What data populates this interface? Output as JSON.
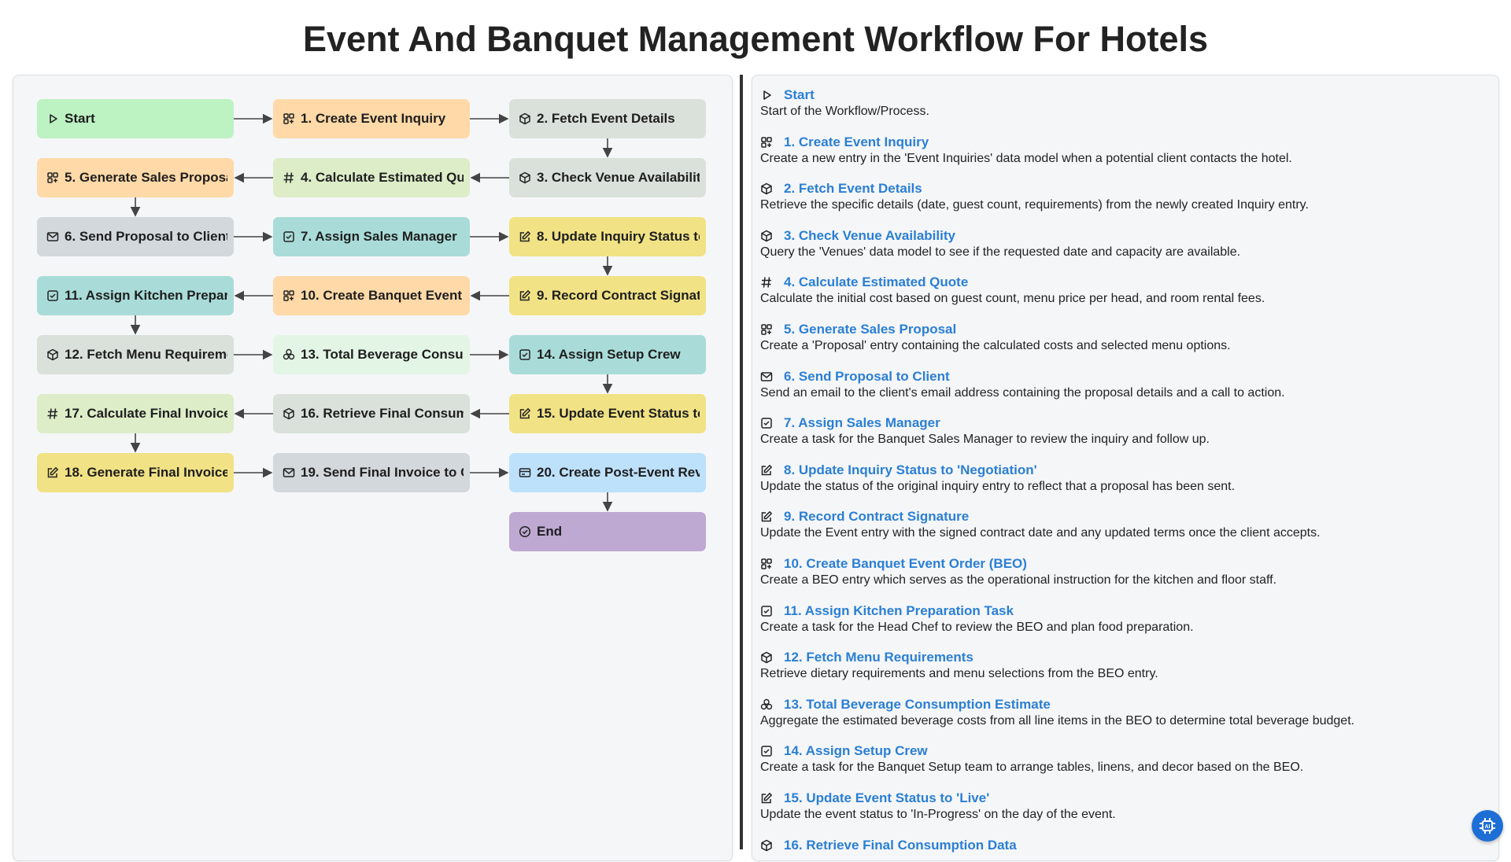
{
  "title": "Event And Banquet Management Workflow For Hotels",
  "colors": {
    "green": "#bdf2c2",
    "orange": "#ffd9a8",
    "gray": "#d9e1da",
    "lime": "#dcedc8",
    "slate": "#d2d8dc",
    "teal": "#a9dcd9",
    "yellow": "#f1e285",
    "mint": "#e3f5e5",
    "blue": "#bde0fb",
    "purple": "#bea9d2",
    "link": "#2a7fd4"
  },
  "nodes": [
    {
      "id": "start",
      "label": "Start",
      "icon": "play-icon",
      "color": "#bdf2c2"
    },
    {
      "id": "n1",
      "label": "1. Create Event Inquiry",
      "icon": "grid-plus-icon",
      "color": "#ffd9a8"
    },
    {
      "id": "n2",
      "label": "2. Fetch Event Details",
      "icon": "cube-icon",
      "color": "#d9e1da"
    },
    {
      "id": "n3",
      "label": "3. Check Venue Availability",
      "icon": "cube-icon",
      "color": "#d9e1da"
    },
    {
      "id": "n4",
      "label": "4. Calculate Estimated Quo",
      "icon": "hash-icon",
      "color": "#dcedc8"
    },
    {
      "id": "n5",
      "label": "5. Generate Sales Proposal",
      "icon": "grid-plus-icon",
      "color": "#ffd9a8"
    },
    {
      "id": "n6",
      "label": "6. Send Proposal to Client",
      "icon": "mail-icon",
      "color": "#d2d8dc"
    },
    {
      "id": "n7",
      "label": "7. Assign Sales Manager",
      "icon": "check-square-icon",
      "color": "#a9dcd9"
    },
    {
      "id": "n8",
      "label": "8. Update Inquiry Status to",
      "icon": "edit-icon",
      "color": "#f1e285"
    },
    {
      "id": "n9",
      "label": "9. Record Contract Signatu",
      "icon": "edit-icon",
      "color": "#f1e285"
    },
    {
      "id": "n10",
      "label": "10. Create Banquet Event C",
      "icon": "grid-plus-icon",
      "color": "#ffd9a8"
    },
    {
      "id": "n11",
      "label": "11. Assign Kitchen Prepara",
      "icon": "check-square-icon",
      "color": "#a9dcd9"
    },
    {
      "id": "n12",
      "label": "12. Fetch Menu Requireme",
      "icon": "cube-icon",
      "color": "#d9e1da"
    },
    {
      "id": "n13",
      "label": "13. Total Beverage Consum",
      "icon": "cubes-icon",
      "color": "#e3f5e5"
    },
    {
      "id": "n14",
      "label": "14. Assign Setup Crew",
      "icon": "check-square-icon",
      "color": "#a9dcd9"
    },
    {
      "id": "n15",
      "label": "15. Update Event Status to",
      "icon": "edit-icon",
      "color": "#f1e285"
    },
    {
      "id": "n16",
      "label": "16. Retrieve Final Consump",
      "icon": "cube-icon",
      "color": "#d9e1da"
    },
    {
      "id": "n17",
      "label": "17. Calculate Final Invoice ,",
      "icon": "hash-icon",
      "color": "#dcedc8"
    },
    {
      "id": "n18",
      "label": "18. Generate Final Invoice",
      "icon": "edit-icon",
      "color": "#f1e285"
    },
    {
      "id": "n19",
      "label": "19. Send Final Invoice to Cl",
      "icon": "mail-icon",
      "color": "#d2d8dc"
    },
    {
      "id": "n20",
      "label": "20. Create Post-Event Reve",
      "icon": "card-icon",
      "color": "#bde0fb"
    },
    {
      "id": "end",
      "label": "End",
      "icon": "check-circle-icon",
      "color": "#bea9d2"
    }
  ],
  "steps": [
    {
      "title": "Start",
      "icon": "play-icon",
      "desc": "Start of the Workflow/Process."
    },
    {
      "title": "1. Create Event Inquiry",
      "icon": "grid-plus-icon",
      "desc": "Create a new entry in the 'Event Inquiries' data model when a potential client contacts the hotel."
    },
    {
      "title": "2. Fetch Event Details",
      "icon": "cube-icon",
      "desc": "Retrieve the specific details (date, guest count, requirements) from the newly created Inquiry entry."
    },
    {
      "title": "3. Check Venue Availability",
      "icon": "cube-icon",
      "desc": "Query the 'Venues' data model to see if the requested date and capacity are available."
    },
    {
      "title": "4. Calculate Estimated Quote",
      "icon": "hash-icon",
      "desc": "Calculate the initial cost based on guest count, menu price per head, and room rental fees."
    },
    {
      "title": "5. Generate Sales Proposal",
      "icon": "grid-plus-icon",
      "desc": "Create a 'Proposal' entry containing the calculated costs and selected menu options."
    },
    {
      "title": "6. Send Proposal to Client",
      "icon": "mail-icon",
      "desc": "Send an email to the client's email address containing the proposal details and a call to action."
    },
    {
      "title": "7. Assign Sales Manager",
      "icon": "check-square-icon",
      "desc": "Create a task for the Banquet Sales Manager to review the inquiry and follow up."
    },
    {
      "title": "8. Update Inquiry Status to 'Negotiation'",
      "icon": "edit-icon",
      "desc": "Update the status of the original inquiry entry to reflect that a proposal has been sent."
    },
    {
      "title": "9. Record Contract Signature",
      "icon": "edit-icon",
      "desc": "Update the Event entry with the signed contract date and any updated terms once the client accepts."
    },
    {
      "title": "10. Create Banquet Event Order (BEO)",
      "icon": "grid-plus-icon",
      "desc": "Create a BEO entry which serves as the operational instruction for the kitchen and floor staff."
    },
    {
      "title": "11. Assign Kitchen Preparation Task",
      "icon": "check-square-icon",
      "desc": "Create a task for the Head Chef to review the BEO and plan food preparation."
    },
    {
      "title": "12. Fetch Menu Requirements",
      "icon": "cube-icon",
      "desc": "Retrieve dietary requirements and menu selections from the BEO entry."
    },
    {
      "title": "13. Total Beverage Consumption Estimate",
      "icon": "cubes-icon",
      "desc": "Aggregate the estimated beverage costs from all line items in the BEO to determine total beverage budget."
    },
    {
      "title": "14. Assign Setup Crew",
      "icon": "check-square-icon",
      "desc": "Create a task for the Banquet Setup team to arrange tables, linens, and decor based on the BEO."
    },
    {
      "title": "15. Update Event Status to 'Live'",
      "icon": "edit-icon",
      "desc": "Update the event status to 'In-Progress' on the day of the event."
    },
    {
      "title": "16. Retrieve Final Consumption Data",
      "icon": "cube-icon",
      "desc": ""
    }
  ],
  "fab": {
    "icon": "chip-icon"
  }
}
